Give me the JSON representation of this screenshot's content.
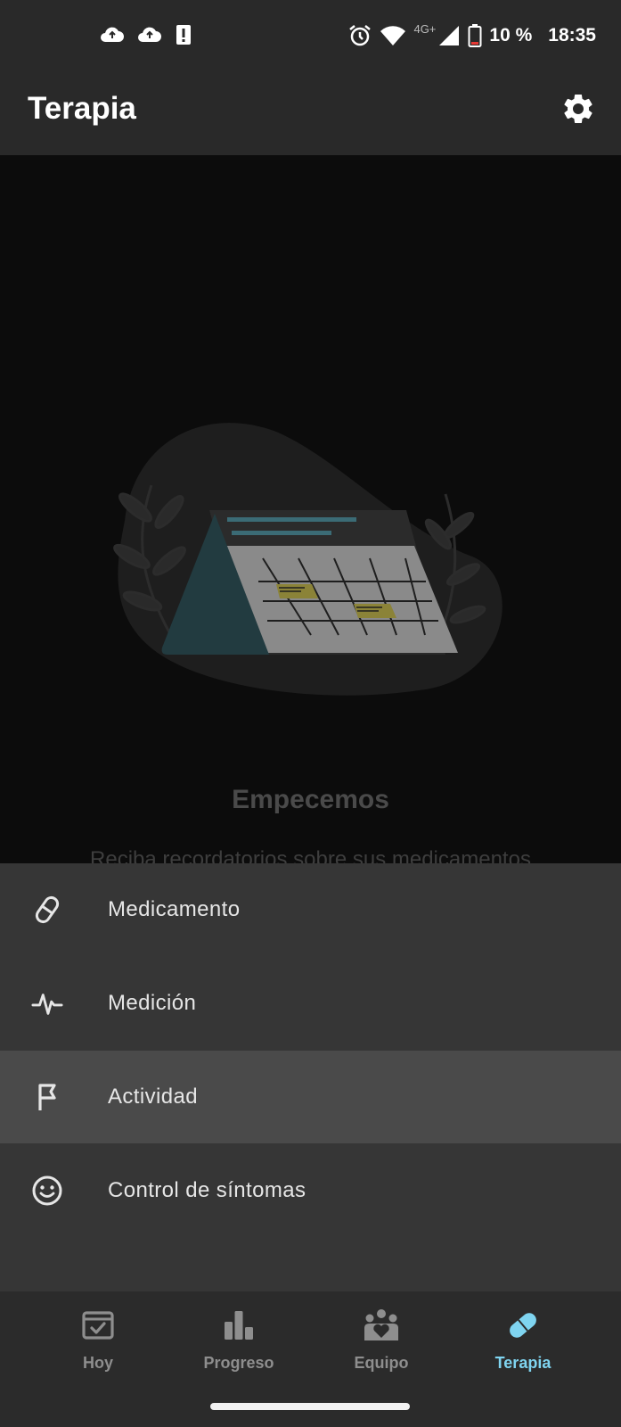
{
  "status_bar": {
    "battery": "10 %",
    "time": "18:35",
    "network": "4G+"
  },
  "app_bar": {
    "title": "Terapia",
    "settings_icon": "gear-icon"
  },
  "empty_state": {
    "title": "Empecemos",
    "description": "Reciba recordatorios sobre sus medicamentos"
  },
  "menu": {
    "items": [
      {
        "label": "Medicamento",
        "icon": "pill-icon"
      },
      {
        "label": "Medición",
        "icon": "pulse-icon"
      },
      {
        "label": "Actividad",
        "icon": "flag-icon",
        "highlighted": true
      },
      {
        "label": "Control de síntomas",
        "icon": "smiley-icon"
      }
    ]
  },
  "bottom_nav": {
    "items": [
      {
        "label": "Hoy",
        "icon": "calendar-check-icon"
      },
      {
        "label": "Progreso",
        "icon": "bar-chart-icon"
      },
      {
        "label": "Equipo",
        "icon": "team-heart-icon"
      },
      {
        "label": "Terapia",
        "icon": "pill-icon",
        "active": true
      }
    ],
    "active_color": "#7fd4f0"
  },
  "colors": {
    "background": "#0c0c0c",
    "bar": "#292929",
    "sheet": "#363636",
    "highlight": "#4a4a4a",
    "accent": "#7fd4f0"
  }
}
